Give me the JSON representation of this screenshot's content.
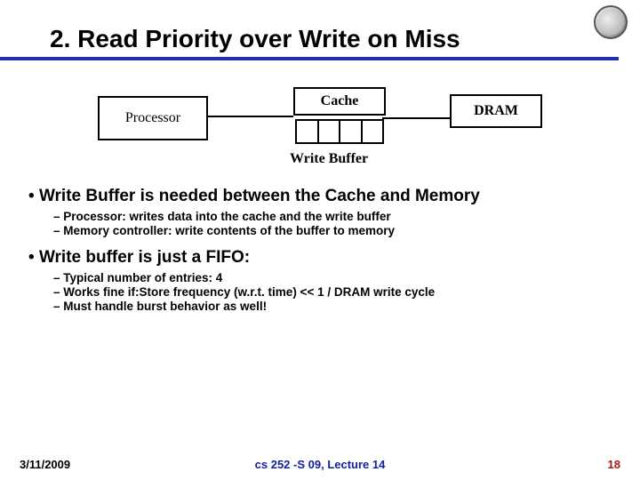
{
  "title": "2. Read Priority over Write on Miss",
  "diagram": {
    "processor": "Processor",
    "cache": "Cache",
    "dram": "DRAM",
    "writeBuffer": "Write Buffer"
  },
  "bullets": {
    "b1": "Write Buffer is needed between the Cache and Memory",
    "b1s1": "Processor: writes data into the cache and the write buffer",
    "b1s2": "Memory controller: write contents of the buffer to memory",
    "b2": "Write buffer is just a FIFO:",
    "b2s1": "Typical number of entries: 4",
    "b2s2": "Works fine if:Store frequency (w.r.t. time) << 1 / DRAM write cycle",
    "b2s3": "Must handle burst behavior as well!"
  },
  "footer": {
    "date": "3/11/2009",
    "course": "cs 252 -S 09, Lecture 14",
    "page": "18"
  }
}
